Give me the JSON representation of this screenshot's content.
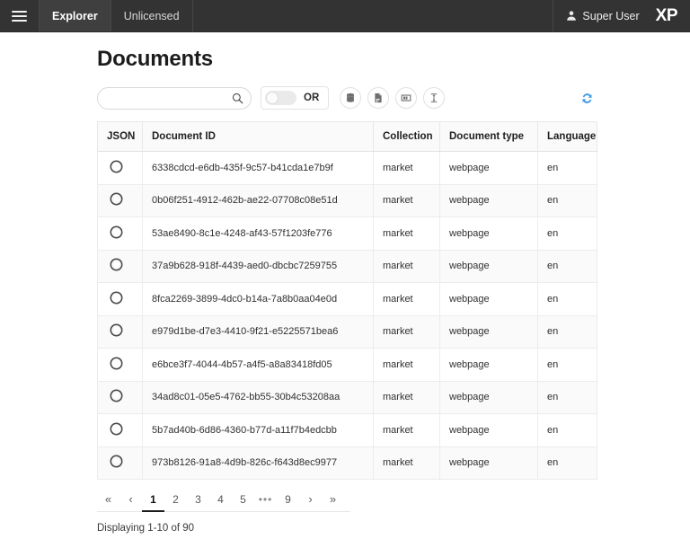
{
  "topbar": {
    "menu_icon": "hamburger-menu-icon",
    "tabs": [
      {
        "label": "Explorer",
        "active": true
      },
      {
        "label": "Unlicensed",
        "active": false
      }
    ],
    "user": {
      "icon": "person-icon",
      "name": "Super User"
    },
    "logo": "XP"
  },
  "page": {
    "title": "Documents"
  },
  "toolbar": {
    "search": {
      "value": "",
      "placeholder": "",
      "icon": "search-icon"
    },
    "toggle": {
      "label": "OR",
      "state": "off"
    },
    "buttons": [
      {
        "name": "database-icon",
        "title": "Collections"
      },
      {
        "name": "document-icon",
        "title": "Document types"
      },
      {
        "name": "columns-icon",
        "title": "Columns"
      },
      {
        "name": "row-height-icon",
        "title": "Row height"
      }
    ],
    "refresh": {
      "icon": "refresh-icon",
      "color": "#3d9ae8"
    }
  },
  "table": {
    "columns": [
      "JSON",
      "Document ID",
      "Collection",
      "Document type",
      "Language"
    ],
    "row_icon": "json-viewer-icon",
    "rows": [
      {
        "document_id": "6338cdcd-e6db-435f-9c57-b41cda1e7b9f",
        "collection": "market",
        "document_type": "webpage",
        "language": "en"
      },
      {
        "document_id": "0b06f251-4912-462b-ae22-07708c08e51d",
        "collection": "market",
        "document_type": "webpage",
        "language": "en"
      },
      {
        "document_id": "53ae8490-8c1e-4248-af43-57f1203fe776",
        "collection": "market",
        "document_type": "webpage",
        "language": "en"
      },
      {
        "document_id": "37a9b628-918f-4439-aed0-dbcbc7259755",
        "collection": "market",
        "document_type": "webpage",
        "language": "en"
      },
      {
        "document_id": "8fca2269-3899-4dc0-b14a-7a8b0aa04e0d",
        "collection": "market",
        "document_type": "webpage",
        "language": "en"
      },
      {
        "document_id": "e979d1be-d7e3-4410-9f21-e5225571bea6",
        "collection": "market",
        "document_type": "webpage",
        "language": "en"
      },
      {
        "document_id": "e6bce3f7-4044-4b57-a4f5-a8a83418fd05",
        "collection": "market",
        "document_type": "webpage",
        "language": "en"
      },
      {
        "document_id": "34ad8c01-05e5-4762-bb55-30b4c53208aa",
        "collection": "market",
        "document_type": "webpage",
        "language": "en"
      },
      {
        "document_id": "5b7ad40b-6d86-4360-b77d-a11f7b4edcbb",
        "collection": "market",
        "document_type": "webpage",
        "language": "en"
      },
      {
        "document_id": "973b8126-91a8-4d9b-826c-f643d8ec9977",
        "collection": "market",
        "document_type": "webpage",
        "language": "en"
      }
    ]
  },
  "pagination": {
    "items": [
      {
        "label": "«",
        "kind": "arrow",
        "name": "first"
      },
      {
        "label": "‹",
        "kind": "arrow",
        "name": "previous"
      },
      {
        "label": "1",
        "kind": "page",
        "active": true
      },
      {
        "label": "2",
        "kind": "page"
      },
      {
        "label": "3",
        "kind": "page"
      },
      {
        "label": "4",
        "kind": "page"
      },
      {
        "label": "5",
        "kind": "page"
      },
      {
        "label": "•••",
        "kind": "dots",
        "name": "ellipsis"
      },
      {
        "label": "9",
        "kind": "page"
      },
      {
        "label": "›",
        "kind": "arrow",
        "name": "next"
      },
      {
        "label": "»",
        "kind": "arrow",
        "name": "last"
      }
    ],
    "status": "Displaying 1-10 of 90"
  }
}
